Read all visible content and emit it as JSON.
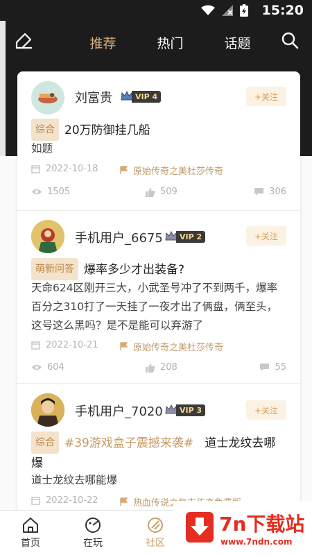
{
  "status": {
    "time": "15:20"
  },
  "header": {
    "tabs": [
      {
        "label": "推荐",
        "active": true
      },
      {
        "label": "热门",
        "active": false
      },
      {
        "label": "话题",
        "active": false
      }
    ],
    "accent_color": "#d6b07e"
  },
  "posts": [
    {
      "username": "刘富贵",
      "vip": "VIP 4",
      "follow_label": "+关注",
      "tag": "综合",
      "title": "20万防御挂几船",
      "body": "如题",
      "date": "2022-10-18",
      "game": "原始传奇之美杜莎传奇",
      "views": "1505",
      "likes": "509",
      "comments": "306"
    },
    {
      "username": "手机用户_6675",
      "vip": "VIP 2",
      "follow_label": "+关注",
      "tag": "萌新问答",
      "title": "爆率多少才出装备?",
      "body": "天命624区刚开三大，小武圣号冲了不到两千，爆率百分之310打了一天挂了一夜才出了俩盘，俩至头，这号这么黑吗？是不是能可以弃游了",
      "date": "2022-10-21",
      "game": "原始传奇之美杜莎传奇",
      "views": "604",
      "likes": "208",
      "comments": "55"
    },
    {
      "username": "手机用户_7020",
      "vip": "VIP 3",
      "follow_label": "+关注",
      "tag": "综合",
      "hashtag": "#39游戏盒子震撼来袭#",
      "title": "道士龙纹去哪爆",
      "body": "道士龙纹去哪能爆",
      "date": "2022-10-22",
      "game": "热血传说之复古传奇免费版"
    }
  ],
  "bottom_nav": [
    {
      "label": "首页",
      "icon": "home-icon",
      "active": false
    },
    {
      "label": "在玩",
      "icon": "gamepad-icon",
      "active": false
    },
    {
      "label": "社区",
      "icon": "community-icon",
      "active": true
    }
  ],
  "watermark": {
    "title": "7n下载站",
    "url": "www.7ndn.com"
  }
}
